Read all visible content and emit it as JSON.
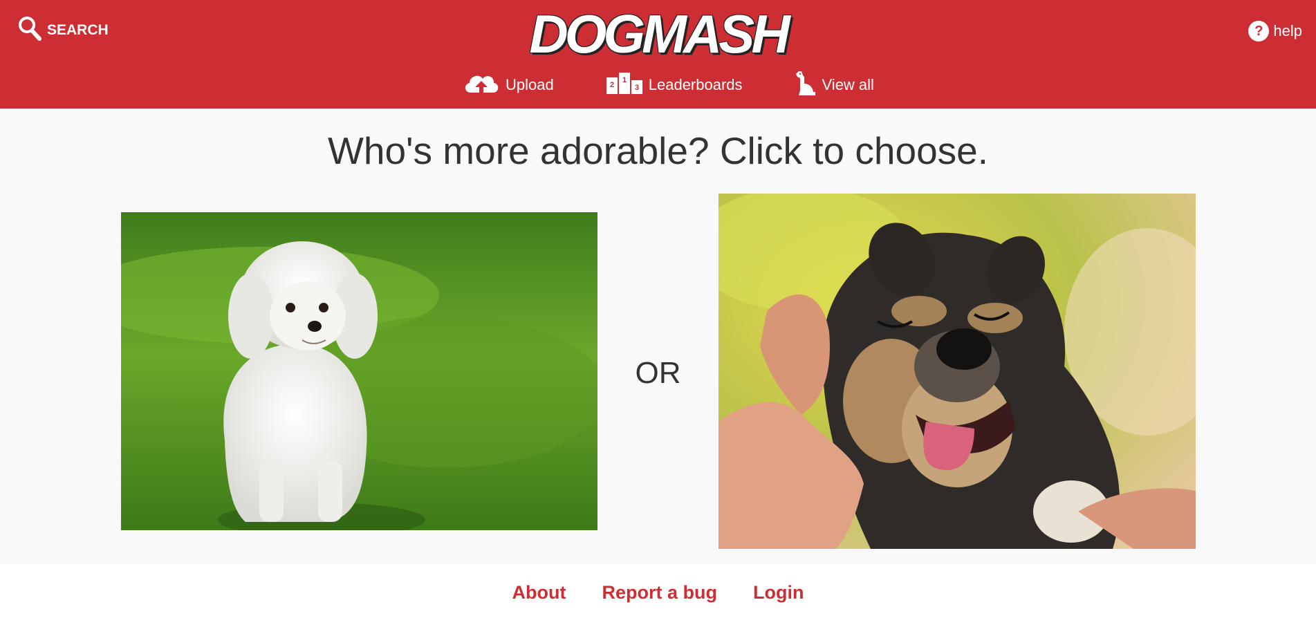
{
  "header": {
    "search_label": "SEARCH",
    "logo": "DOGMASH",
    "help_label": "help",
    "nav": [
      {
        "label": "Upload",
        "icon": "cloud-upload-icon"
      },
      {
        "label": "Leaderboards",
        "icon": "podium-icon"
      },
      {
        "label": "View all",
        "icon": "dog-sitting-icon"
      }
    ]
  },
  "main": {
    "prompt": "Who's more adorable? Click to choose.",
    "separator": "OR",
    "left_photo": {
      "subject": "white fluffy dog sitting on green grass"
    },
    "right_photo": {
      "subject": "happy black and tan dog being petted by a hand"
    }
  },
  "footer": {
    "links": [
      "About",
      "Report a bug",
      "Login"
    ]
  },
  "colors": {
    "brand": "#cc2e34",
    "text": "#333333",
    "background": "#f9f9f9"
  }
}
